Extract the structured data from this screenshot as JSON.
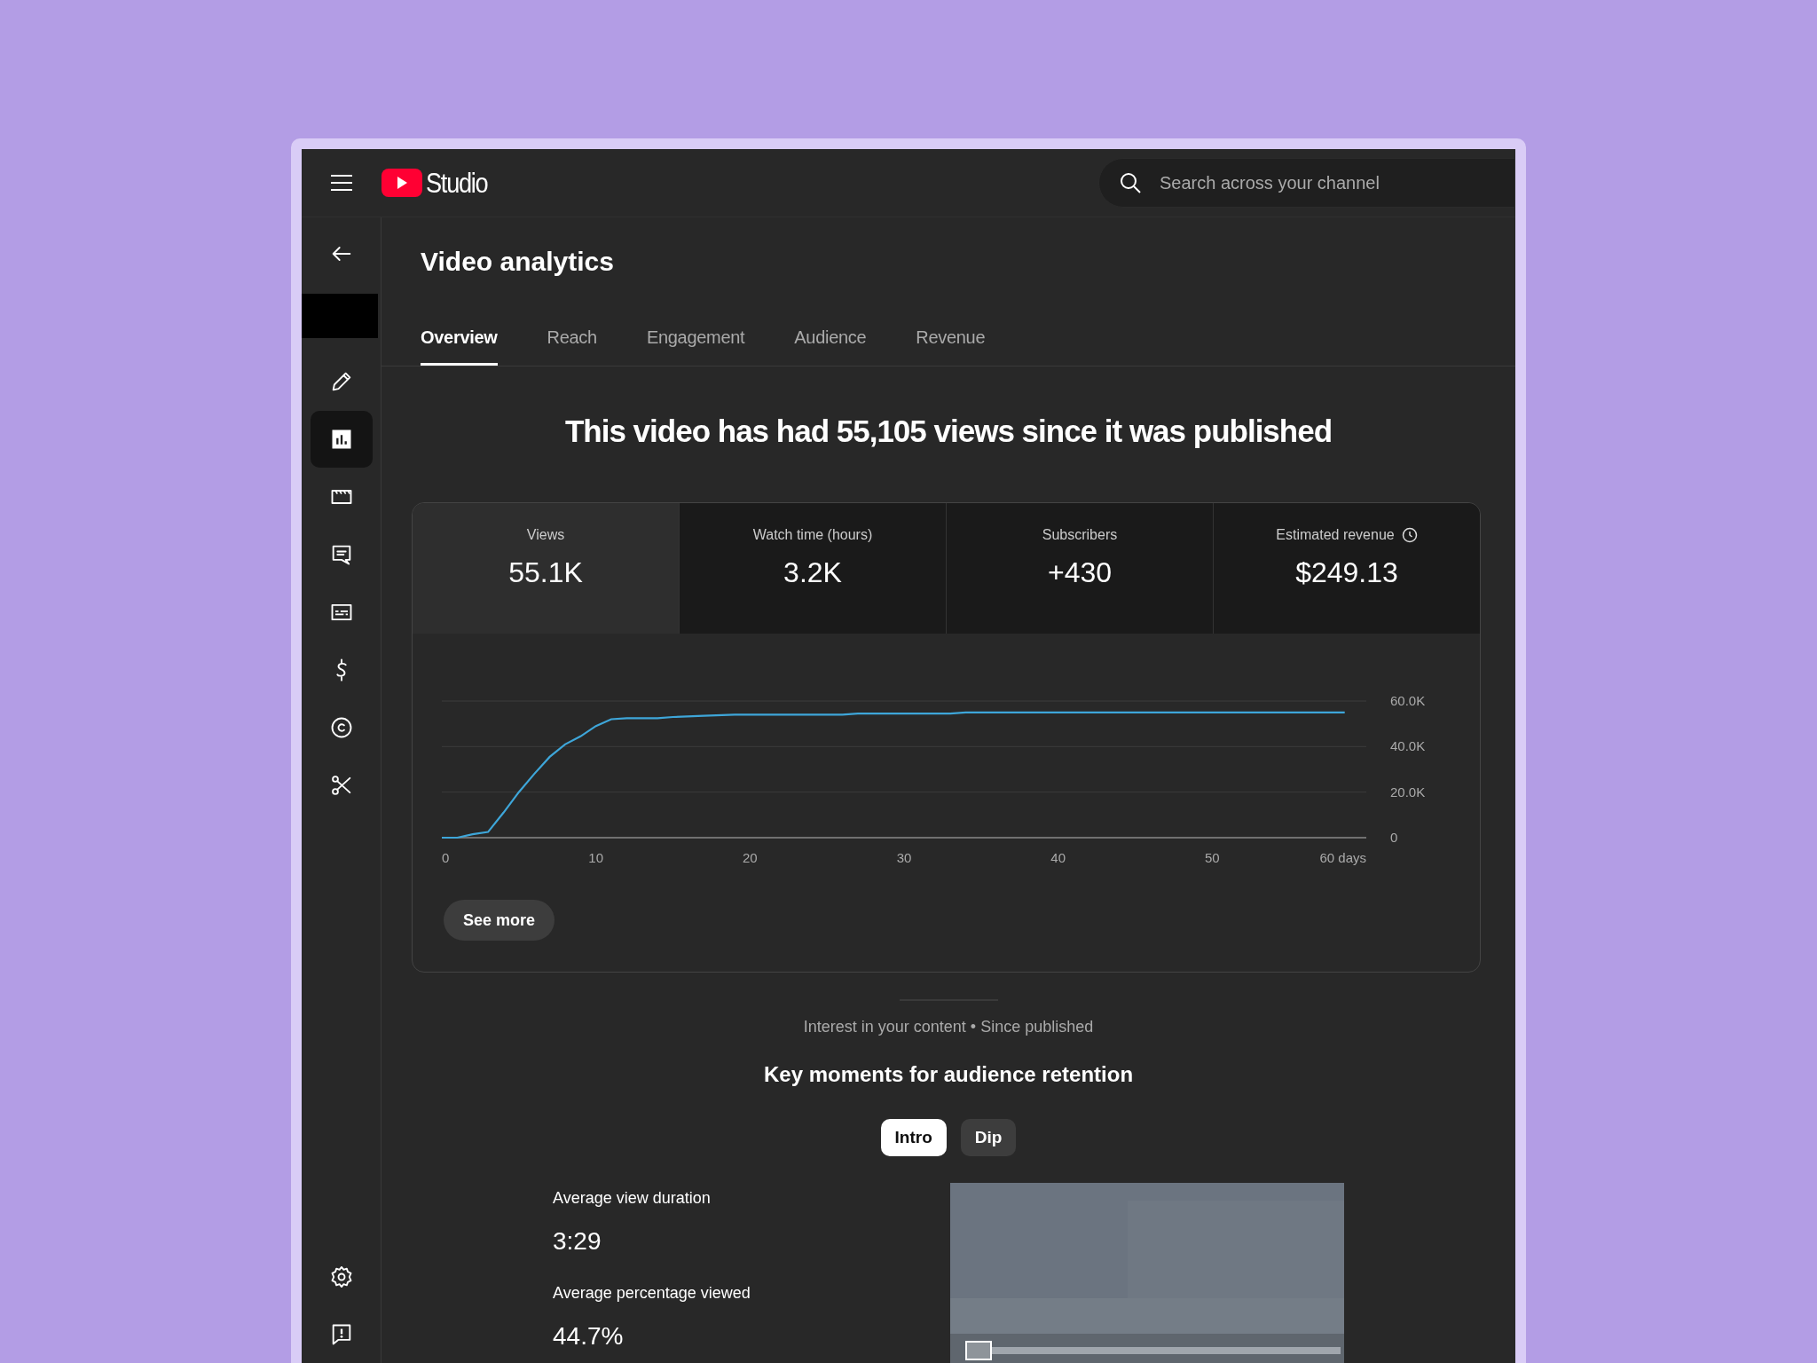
{
  "app": {
    "logo_text": "Studio"
  },
  "search": {
    "placeholder": "Search across your channel"
  },
  "sidebar": {
    "items": [
      {
        "selected": false
      },
      {
        "selected": true
      },
      {
        "selected": false
      },
      {
        "selected": false
      },
      {
        "selected": false
      },
      {
        "selected": false
      },
      {
        "selected": false
      },
      {
        "selected": false
      },
      {
        "selected": false
      },
      {
        "selected": false
      }
    ]
  },
  "page": {
    "title": "Video analytics",
    "tabs": [
      {
        "label": "Overview",
        "selected": true
      },
      {
        "label": "Reach",
        "selected": false
      },
      {
        "label": "Engagement",
        "selected": false
      },
      {
        "label": "Audience",
        "selected": false
      },
      {
        "label": "Revenue",
        "selected": false
      }
    ],
    "headline": "This video has had 55,105 views since it was published"
  },
  "overview_card": {
    "stats": [
      {
        "label": "Views",
        "value": "55.1K",
        "selected": true,
        "info": false
      },
      {
        "label": "Watch time (hours)",
        "value": "3.2K",
        "selected": false,
        "info": false
      },
      {
        "label": "Subscribers",
        "value": "+430",
        "selected": false,
        "info": false
      },
      {
        "label": "Estimated revenue",
        "value": "$249.13",
        "selected": false,
        "info": true
      }
    ],
    "chart_data": {
      "type": "line",
      "x": [
        0,
        1,
        2,
        3,
        4,
        5,
        6,
        7,
        8,
        9,
        10,
        11,
        12,
        14,
        15,
        17,
        19,
        26,
        27,
        33,
        34,
        58.6
      ],
      "series": [
        {
          "color": "#3ea6d9",
          "values": [
            0,
            0,
            1500,
            2500,
            11000,
            20000,
            28000,
            35500,
            41000,
            44500,
            49000,
            52000,
            52500,
            52500,
            53000,
            53500,
            54000,
            54000,
            54500,
            54500,
            55000,
            55000
          ]
        }
      ],
      "xlim": [
        0,
        60
      ],
      "ylim": [
        0,
        60000
      ],
      "xticks": [
        0,
        10,
        20,
        30,
        40,
        50,
        {
          "value": 60,
          "label": "60 days"
        }
      ],
      "yticks": [
        0,
        {
          "value": 20000,
          "label": "20.0K"
        },
        {
          "value": 40000,
          "label": "40.0K"
        },
        {
          "value": 60000,
          "label": "60.0K"
        }
      ]
    },
    "button": "See more"
  },
  "retention": {
    "caption": "Interest in your content • Since published",
    "title": "Key moments for audience retention",
    "chips": [
      {
        "label": "Intro",
        "selected": true
      },
      {
        "label": "Dip",
        "selected": false
      }
    ],
    "metrics": [
      {
        "label": "Average view duration",
        "value": "3:29"
      },
      {
        "label": "Average percentage viewed",
        "value": "44.7%"
      }
    ]
  }
}
